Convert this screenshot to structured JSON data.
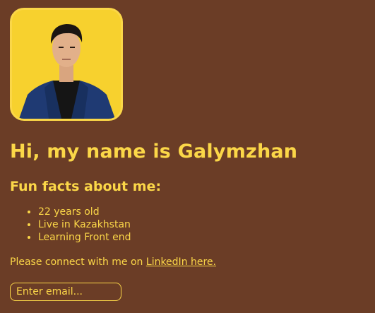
{
  "profile": {
    "heading": "Hi, my name is Galymzhan",
    "facts_heading": "Fun facts about me:",
    "facts": [
      "22 years old",
      "Live in Kazakhstan",
      "Learning Front end"
    ],
    "connect_text": "Please connect with me on ",
    "connect_link": "LinkedIn here.",
    "email_placeholder": "Enter email..."
  },
  "colors": {
    "background": "#6b3d26",
    "accent": "#fbd748"
  }
}
